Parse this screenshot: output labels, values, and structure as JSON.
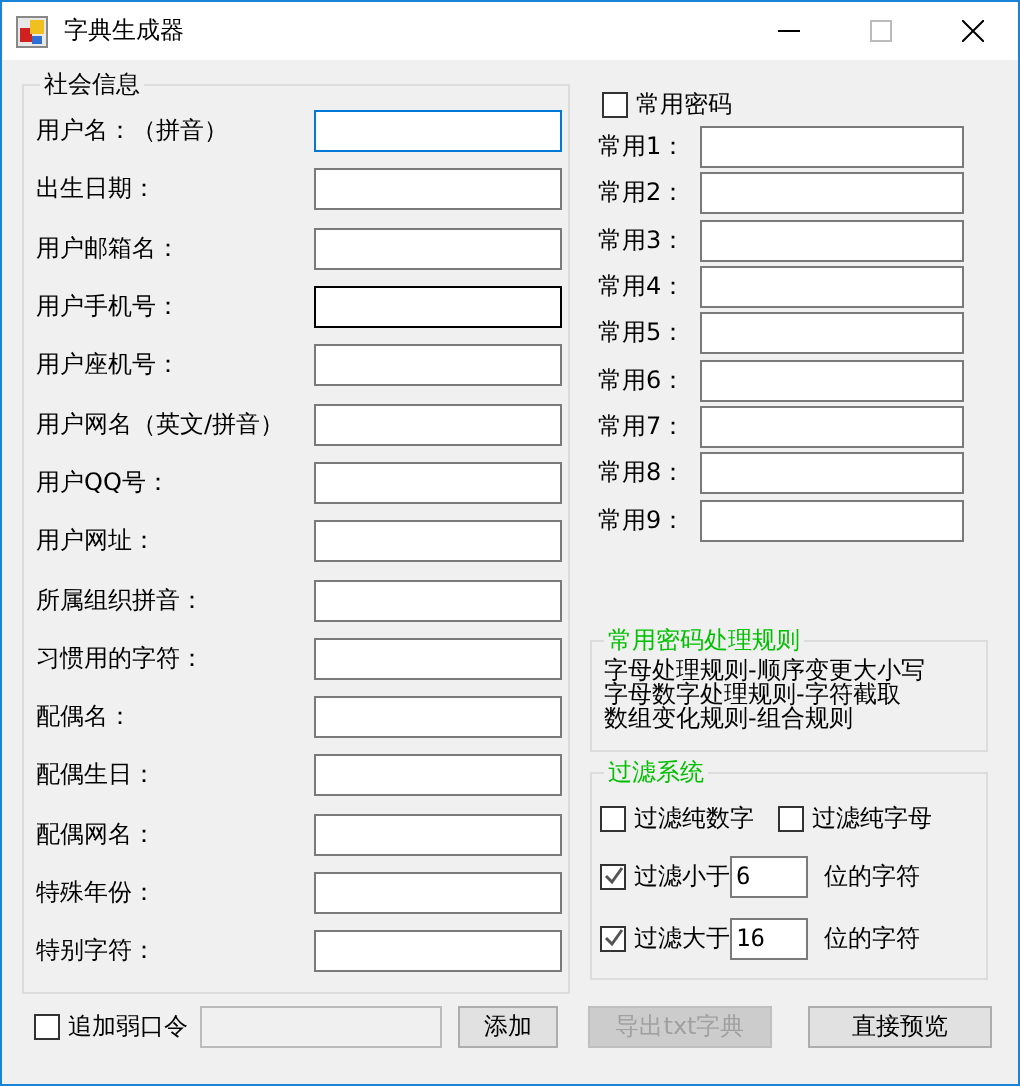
{
  "window": {
    "title": "字典生成器"
  },
  "social_info": {
    "title": "社会信息",
    "fields": [
      {
        "label": "用户名：（拼音）",
        "focused": true,
        "hovered": false
      },
      {
        "label": "出生日期：",
        "focused": false,
        "hovered": false
      },
      {
        "label": "用户邮箱名：",
        "focused": false,
        "hovered": false
      },
      {
        "label": "用户手机号：",
        "focused": false,
        "hovered": true
      },
      {
        "label": "用户座机号：",
        "focused": false,
        "hovered": false
      },
      {
        "label": "用户网名（英文/拼音）",
        "focused": false,
        "hovered": false
      },
      {
        "label": "用户QQ号：",
        "focused": false,
        "hovered": false
      },
      {
        "label": "用户网址：",
        "focused": false,
        "hovered": false
      },
      {
        "label": "所属组织拼音：",
        "focused": false,
        "hovered": false
      },
      {
        "label": "习惯用的字符：",
        "focused": false,
        "hovered": false
      },
      {
        "label": "配偶名：",
        "focused": false,
        "hovered": false
      },
      {
        "label": "配偶生日：",
        "focused": false,
        "hovered": false
      },
      {
        "label": "配偶网名：",
        "focused": false,
        "hovered": false
      },
      {
        "label": "特殊年份：",
        "focused": false,
        "hovered": false
      },
      {
        "label": "特别字符：",
        "focused": false,
        "hovered": false
      }
    ]
  },
  "common_passwords": {
    "checkbox": {
      "label": "常用密码",
      "checked": false
    },
    "fields": [
      {
        "label": "常用1："
      },
      {
        "label": "常用2："
      },
      {
        "label": "常用3："
      },
      {
        "label": "常用4："
      },
      {
        "label": "常用5："
      },
      {
        "label": "常用6："
      },
      {
        "label": "常用7："
      },
      {
        "label": "常用8："
      },
      {
        "label": "常用9："
      }
    ]
  },
  "rules": {
    "title": "常用密码处理规则",
    "lines": [
      "字母处理规则-顺序变更大小写",
      "字母数字处理规则-字符截取",
      "数组变化规则-组合规则"
    ]
  },
  "filter": {
    "title": "过滤系统",
    "pure": [
      {
        "label": "过滤纯数字",
        "checked": false
      },
      {
        "label": "过滤纯字母",
        "checked": false
      }
    ],
    "lengths": [
      {
        "label": "过滤小于",
        "checked": true,
        "value": "6",
        "suffix": "位的字符"
      },
      {
        "label": "过滤大于",
        "checked": true,
        "value": "16",
        "suffix": "位的字符"
      }
    ]
  },
  "bottom": {
    "weak_password": {
      "label": "追加弱口令",
      "checked": false
    },
    "add_button": "添加",
    "export_button": {
      "label": "导出txt字典",
      "disabled": true
    },
    "preview_button": "直接预览"
  }
}
